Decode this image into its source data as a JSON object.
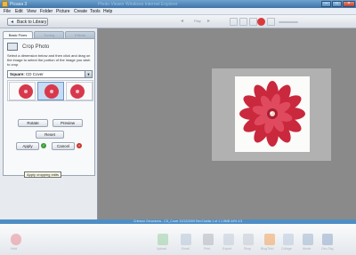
{
  "window": {
    "title": "Picasa 3",
    "subtitle": "Photo Viewer   Windows Internet Explorer"
  },
  "menu": [
    "File",
    "Edit",
    "View",
    "Folder",
    "Picture",
    "Create",
    "Tools",
    "Help"
  ],
  "toolbar": {
    "back_label": "Back to Library",
    "play_label": "Play"
  },
  "tabs": [
    "Basic Fixes",
    "Tuning",
    "Effects"
  ],
  "crop": {
    "title": "Crop Photo",
    "instructions": "Select a dimension below and then click and drag on the image to select the portion of the image you wish to crop.",
    "selected_dimension_bold": "Square:",
    "selected_dimension_rest": " CD Cover",
    "rotate_label": "Rotate",
    "preview_label": "Preview",
    "reset_label": "Reset",
    "apply_label": "Apply",
    "cancel_label": "Cancel",
    "tooltip": "Apply cropping edits"
  },
  "statusbar": {
    "text": "Crimson Geraniums - CD_Cover  10/12/2009 Red Dahlia     1 of 1    1.5MB    44% 4:3"
  },
  "tray": [
    "Hold",
    "Upload",
    "Email",
    "Print",
    "Export",
    "Shop",
    "BlogThis!",
    "Collage",
    "Movie",
    "Geo-Tag"
  ],
  "colors": {
    "accent": "#4f8ec5",
    "flower": "#d8384c",
    "workspace": "#8a8a8a"
  }
}
